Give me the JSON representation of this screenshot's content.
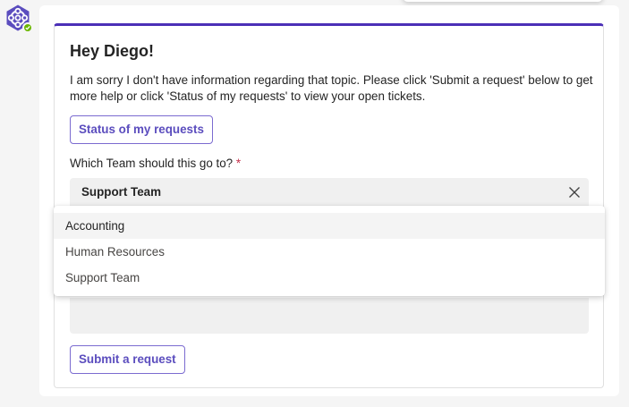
{
  "bot": {
    "avatar_icon": "bot-hexagon-icon",
    "status_icon": "available-check-icon",
    "status_color": "#6bb700",
    "brand_color": "#5b4dbe"
  },
  "card": {
    "title": "Hey Diego!",
    "body_text": "I am sorry I don't have information regarding that topic. Please click 'Submit a request' below to get more help or click 'Status of my requests' to view your open tickets.",
    "status_button_label": "Status of my requests",
    "team_label": "Which Team should this go to?",
    "required_mark": "*",
    "team_selected_value": "Support Team",
    "clear_icon": "close-icon",
    "submit_button_label": "Submit a request",
    "accent_color": "#4b2fb7"
  },
  "dropdown": {
    "options": [
      {
        "label": "Accounting",
        "highlighted": true
      },
      {
        "label": "Human Resources",
        "highlighted": false
      },
      {
        "label": "Support Team",
        "highlighted": false
      }
    ]
  }
}
